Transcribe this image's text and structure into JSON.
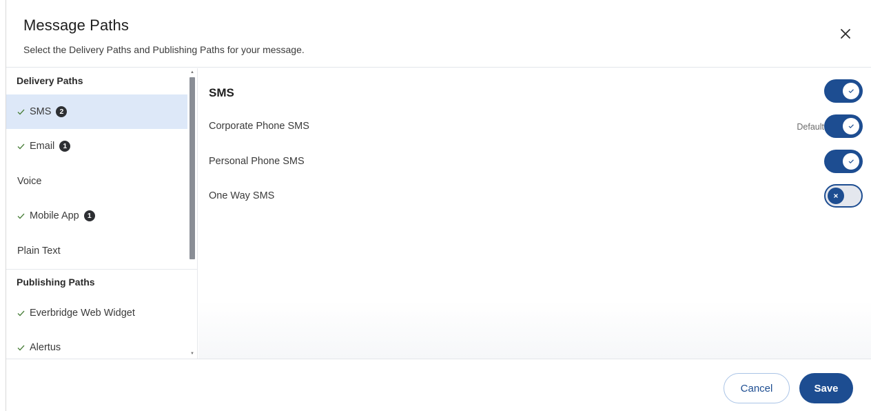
{
  "header": {
    "title": "Message Paths",
    "subtitle": "Select the Delivery Paths and Publishing Paths for your message."
  },
  "sidebar": {
    "delivery_heading": "Delivery Paths",
    "delivery_items": [
      {
        "label": "SMS",
        "checked": true,
        "badge": "2",
        "active": true
      },
      {
        "label": "Email",
        "checked": true,
        "badge": "1",
        "active": false
      },
      {
        "label": "Voice",
        "checked": false,
        "badge": "",
        "active": false
      },
      {
        "label": "Mobile App",
        "checked": true,
        "badge": "1",
        "active": false
      },
      {
        "label": "Plain Text",
        "checked": false,
        "badge": "",
        "active": false
      }
    ],
    "publishing_heading": "Publishing Paths",
    "publishing_items": [
      {
        "label": "Everbridge Web Widget",
        "checked": true
      },
      {
        "label": "Alertus",
        "checked": true
      }
    ]
  },
  "content": {
    "title": "SMS",
    "master_toggle": true,
    "rows": [
      {
        "label": "Corporate Phone SMS",
        "tag": "Default",
        "enabled": true
      },
      {
        "label": "Personal Phone SMS",
        "tag": "",
        "enabled": true
      },
      {
        "label": "One Way SMS",
        "tag": "",
        "enabled": false
      }
    ]
  },
  "footer": {
    "cancel_label": "Cancel",
    "save_label": "Save"
  },
  "colors": {
    "primary": "#1d4d91",
    "active_bg": "#dde8f8",
    "check": "#4a7f3a"
  }
}
